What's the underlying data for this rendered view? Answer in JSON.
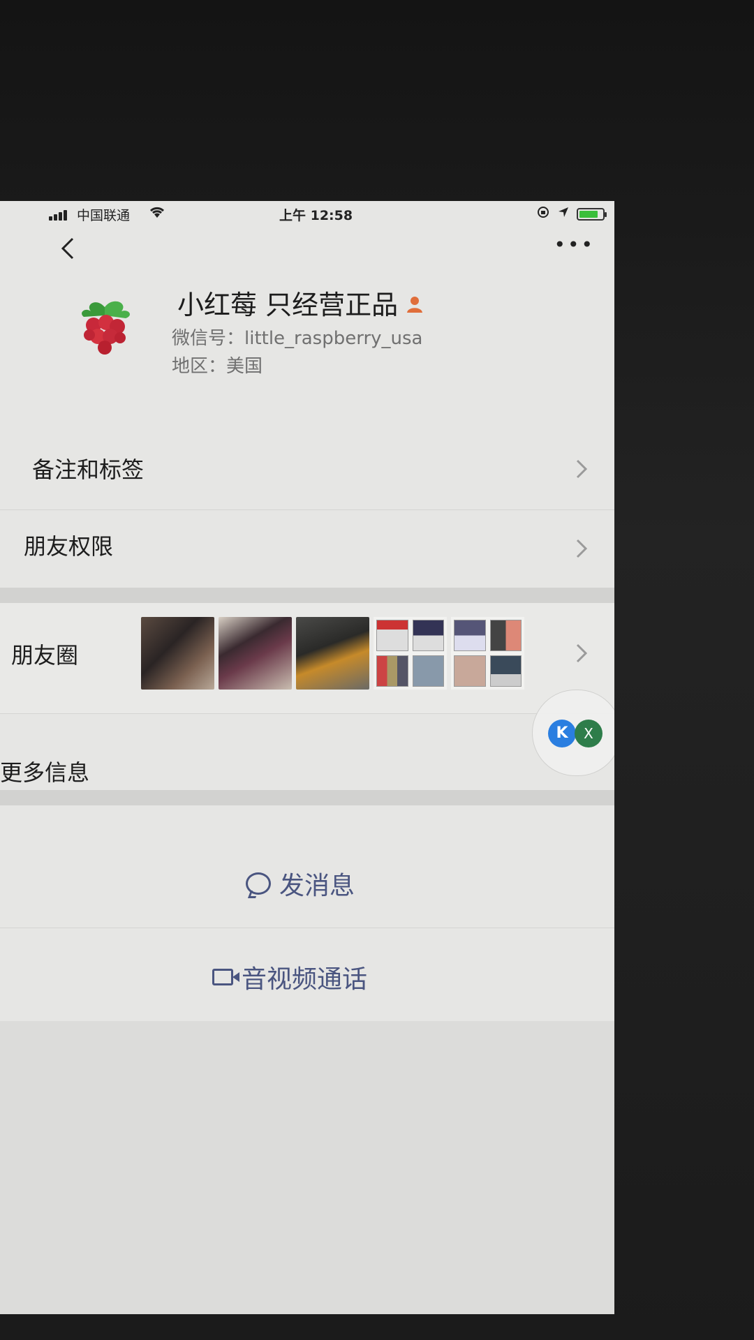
{
  "status_bar": {
    "carrier": "中国联通",
    "time": "上午 12:58"
  },
  "nav": {
    "back_icon": "chevron-left-icon",
    "more_label": "•••"
  },
  "profile": {
    "avatar_icon": "raspberry-icon",
    "name": "小红莓 只经营正品",
    "badge_icon": "person-badge-icon",
    "wechat_id": "微信号：little_raspberry_usa",
    "region": "地区：美国"
  },
  "rows": {
    "notes": "备注和标签",
    "permissions": "朋友权限",
    "moments": "朋友圈",
    "more_info": "更多信息"
  },
  "actions": {
    "send_message": "发消息",
    "av_call": "音视频通话"
  },
  "floating_widget": {
    "k_label": "K",
    "x_label": "X"
  },
  "colors": {
    "link": "#4a5580",
    "battery": "#3bbf3b"
  }
}
